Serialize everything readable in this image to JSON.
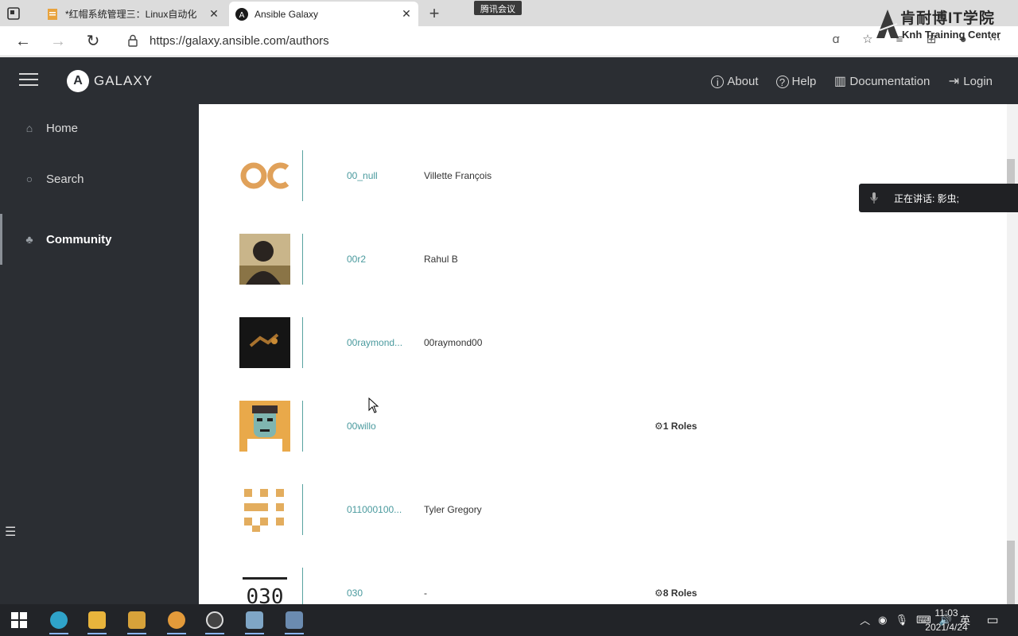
{
  "browser": {
    "tabs": [
      {
        "title": "*红帽系统管理三：Linux自动化",
        "close": "✕"
      },
      {
        "title": "Ansible Galaxy",
        "close": "✕"
      }
    ],
    "new_tab": "+",
    "meeting_badge": "腾讯会议",
    "url": "https://galaxy.ansible.com/authors"
  },
  "watermark": {
    "cn": "肯耐博IT学院",
    "en": "Knh Training Center"
  },
  "header": {
    "logo_letter": "A",
    "brand": "GALAXY",
    "nav": [
      {
        "label": "About",
        "icon": "info-icon"
      },
      {
        "label": "Help",
        "icon": "question-icon"
      },
      {
        "label": "Documentation",
        "icon": "book-icon"
      },
      {
        "label": "Login",
        "icon": "login-icon"
      }
    ]
  },
  "sidebar": {
    "items": [
      {
        "label": "Home",
        "icon": "home-icon"
      },
      {
        "label": "Search",
        "icon": "search-icon"
      },
      {
        "label": "Community",
        "icon": "community-icon",
        "active": true
      }
    ]
  },
  "authors": [
    {
      "username": "00_null",
      "name": "Villette François",
      "roles": ""
    },
    {
      "username": "00r2",
      "name": "Rahul B",
      "roles": ""
    },
    {
      "username": "00raymond...",
      "name": "00raymond00",
      "roles": ""
    },
    {
      "username": "00willo",
      "name": "",
      "roles": "1 Roles"
    },
    {
      "username": "011000100...",
      "name": "Tyler Gregory",
      "roles": ""
    },
    {
      "username": "030",
      "name": "-",
      "roles": "8 Roles"
    }
  ],
  "toast": {
    "text": "正在讲话: 影虫;"
  },
  "taskbar": {
    "time": "11:03",
    "date": "2021/4/24",
    "ime": "英"
  },
  "colors": {
    "header_bg": "#2b2e33",
    "link_teal": "#4a9a9e",
    "divider_teal": "#58a2a0"
  }
}
